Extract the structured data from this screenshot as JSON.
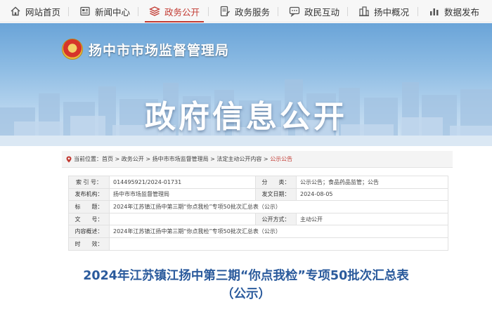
{
  "nav": {
    "items": [
      {
        "label": "网站首页",
        "icon": "home-icon"
      },
      {
        "label": "新闻中心",
        "icon": "news-icon"
      },
      {
        "label": "政务公开",
        "icon": "layers-icon",
        "active": true
      },
      {
        "label": "政务服务",
        "icon": "service-icon"
      },
      {
        "label": "政民互动",
        "icon": "chat-icon"
      },
      {
        "label": "扬中概况",
        "icon": "building-icon"
      },
      {
        "label": "数据发布",
        "icon": "bar-chart-icon"
      }
    ],
    "active_color": "#c23b33"
  },
  "banner": {
    "org_name": "扬中市市场监督管理局",
    "title": "政府信息公开"
  },
  "breadcrumb": {
    "prefix": "当前位置：",
    "items": [
      "首页",
      "政务公开",
      "扬中市市场监督管理局",
      "法定主动公开内容"
    ],
    "current": "公示公告"
  },
  "info": {
    "index_label": "索 引 号：",
    "index_value": "014495921/2024-01731",
    "category_label": "分　　类：",
    "category_value": "公示公告；食品药品监管；公告",
    "publisher_label": "发布机构：",
    "publisher_value": "扬中市市场监督管理局",
    "date_label": "发文日期：",
    "date_value": "2024-08-05",
    "title_label": "标　　题：",
    "title_value": "2024年江苏镇江扬中第三期“你点我检”专项50批次汇总表（公示）",
    "docno_label": "文　　号：",
    "docno_value": "",
    "method_label": "公开方式：",
    "method_value": "主动公开",
    "summary_label": "内容概述：",
    "summary_value": "2024年江苏镇江扬中第三期“你点我检”专项50批次汇总表（公示）",
    "validity_label": "时　　效：",
    "validity_value": ""
  },
  "document": {
    "title_line1": "2024年江苏镇江扬中第三期“你点我检”专项50批次汇总表",
    "title_line2": "（公示）"
  }
}
